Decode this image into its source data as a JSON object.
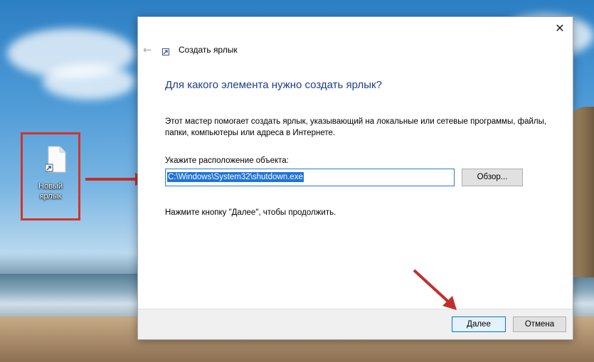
{
  "desktop": {
    "shortcut_label_line1": "Новый",
    "shortcut_label_line2": "ярлык"
  },
  "dialog": {
    "close_glyph": "✕",
    "back_glyph": "←",
    "title": "Создать ярлык",
    "heading": "Для какого элемента нужно создать ярлык?",
    "description": "Этот мастер помогает создать ярлык, указывающий на локальные или сетевые программы, файлы, папки, компьютеры или адреса в Интернете.",
    "location_label": "Укажите расположение объекта:",
    "location_value": "C:\\Windows\\System32\\shutdown.exe",
    "browse_label": "Обзор...",
    "hint": "Нажмите кнопку \"Далее\", чтобы продолжить.",
    "next_label": "Далее",
    "cancel_label": "Отмена"
  },
  "icons": {
    "shortcut": "new-shortcut-icon",
    "back": "back-arrow-icon",
    "close": "close-icon",
    "wizard": "shortcut-wizard-icon"
  },
  "colors": {
    "annotation_red": "#d0342c",
    "heading_blue": "#1e3e8a",
    "selection_blue": "#1f73d8",
    "default_button_border": "#0078d7"
  }
}
